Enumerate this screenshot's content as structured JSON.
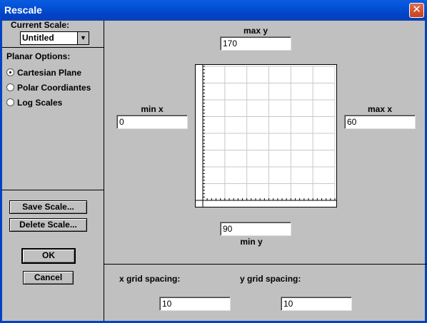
{
  "window": {
    "title": "Rescale",
    "close_glyph": "✕"
  },
  "current_scale": {
    "label": "Current Scale:",
    "value": "Untitled",
    "arrow": "▼"
  },
  "planar": {
    "label": "Planar Options:",
    "options": [
      "Cartesian Plane",
      "Polar Coordiantes",
      "Log Scales"
    ],
    "selected": "Cartesian Plane"
  },
  "buttons": {
    "save_scale": "Save Scale...",
    "delete_scale": "Delete Scale...",
    "ok": "OK",
    "cancel": "Cancel"
  },
  "axes": {
    "max_y_label": "max y",
    "max_y": "170",
    "min_y_label": "min y",
    "min_y": "90",
    "min_x_label": "min x",
    "min_x": "0",
    "max_x_label": "max x",
    "max_x": "60"
  },
  "grid_spacing": {
    "x_label": "x grid spacing:",
    "x_value": "10",
    "y_label": "y grid spacing:",
    "y_value": "10"
  }
}
